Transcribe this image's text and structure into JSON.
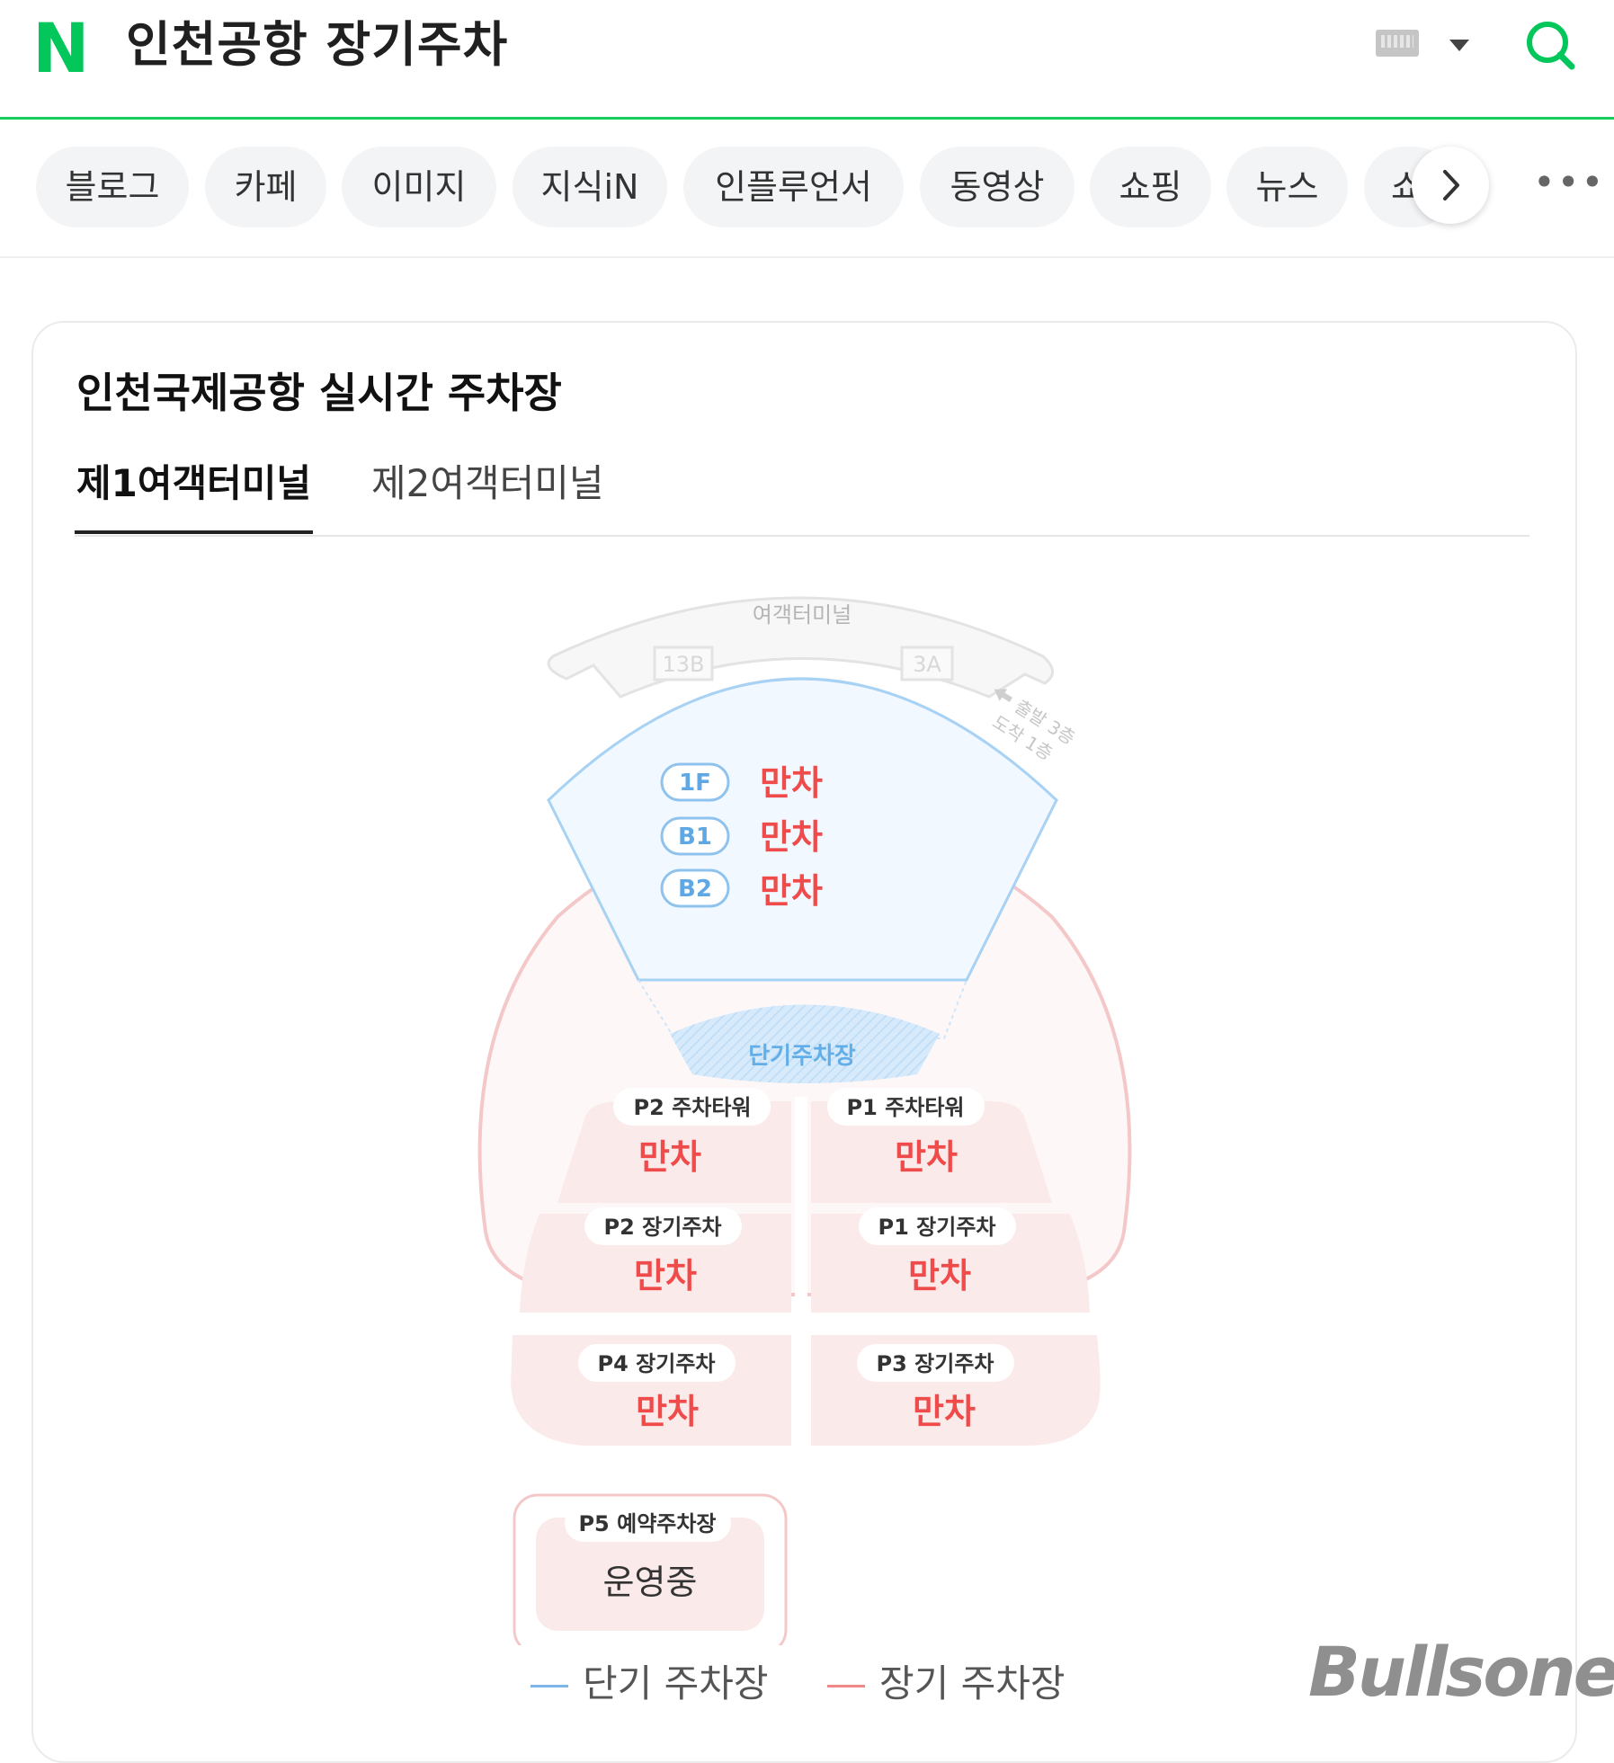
{
  "header": {
    "logo": "N",
    "query": "인천공항 장기주차",
    "keyboard_icon": "keyboard-icon",
    "search_icon": "search-icon"
  },
  "tabs": [
    {
      "label": "블로그"
    },
    {
      "label": "카페"
    },
    {
      "label": "이미지"
    },
    {
      "label": "지식iN"
    },
    {
      "label": "인플루언서"
    },
    {
      "label": "동영상"
    },
    {
      "label": "쇼핑"
    },
    {
      "label": "뉴스"
    },
    {
      "label": "쇼"
    }
  ],
  "card": {
    "title": "인천국제공항 실시간 주차장",
    "terminal_tabs": [
      "제1여객터미널",
      "제2여객터미널"
    ],
    "active_tab": 0
  },
  "map": {
    "terminal_label": "여객터미널",
    "gate_left": "13B",
    "gate_right": "3A",
    "direction_line1": "출발 3층",
    "direction_line2": "도착 1층",
    "short_term_label": "단기주차장",
    "floors": [
      {
        "floor": "1F",
        "status": "만차"
      },
      {
        "floor": "B1",
        "status": "만차"
      },
      {
        "floor": "B2",
        "status": "만차"
      }
    ],
    "lots": {
      "p2_tower": {
        "name": "P2 주차타워",
        "status": "만차"
      },
      "p1_tower": {
        "name": "P1 주차타워",
        "status": "만차"
      },
      "p2_long": {
        "name": "P2 장기주차",
        "status": "만차"
      },
      "p1_long": {
        "name": "P1 장기주차",
        "status": "만차"
      },
      "p4_long": {
        "name": "P4 장기주차",
        "status": "만차"
      },
      "p3_long": {
        "name": "P3 장기주차",
        "status": "만차"
      },
      "p5_reserved": {
        "name": "P5 예약주차장",
        "status": "운영중"
      }
    },
    "colors": {
      "short_term": "#7cb6ea",
      "long_term": "#f0a3a3",
      "full_status": "#f04b4b"
    }
  },
  "legend": {
    "short_term": "단기 주차장",
    "long_term": "장기 주차장"
  },
  "watermark": "Bullsone"
}
